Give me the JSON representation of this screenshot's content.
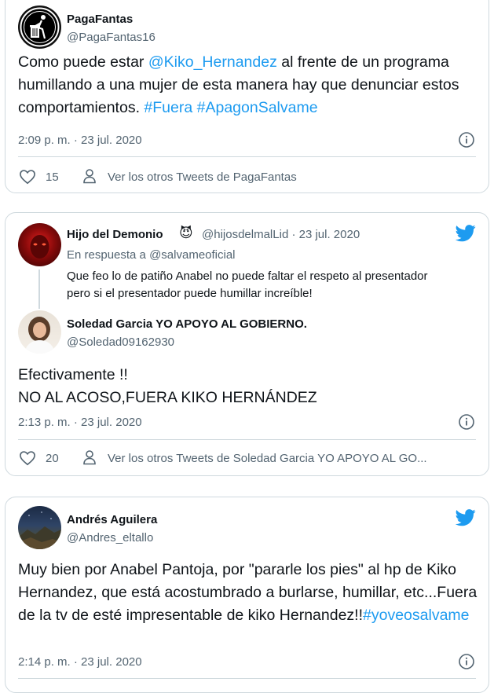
{
  "tweets": [
    {
      "name": "PagaFantas",
      "handle": "@PagaFantas16",
      "text_parts": [
        "Como puede estar ",
        "@Kiko_Hernandez",
        " al frente de un programa humillando a una mujer de esta manera hay que denunciar estos comportamientos. ",
        "#Fuera",
        " ",
        "#ApagonSalvame"
      ],
      "timestamp": "2:09 p. m. · 23 jul. 2020",
      "likes": "15",
      "view_more": "Ver los otros Tweets de PagaFantas"
    },
    {
      "parent": {
        "name": "Hijo del Demonio",
        "emoji": "😈",
        "handle_date": "@hijosdelmalLid · 23 jul. 2020",
        "reply_to_prefix": "En respuesta a ",
        "reply_to_handle": "@salvameoficial",
        "text_line1": "Que feo lo de patiño Anabel no puede faltar el respeto al presentador",
        "text_line2": "pero si el presentador puede humillar increíble!"
      },
      "name": "Soledad Garcia YO APOYO AL GOBIERNO.",
      "handle": "@Soledad09162930",
      "text_line1": "Efectivamente !!",
      "text_line2": "NO AL ACOSO,FUERA KIKO HERNÁNDEZ",
      "timestamp": "2:13 p. m. · 23 jul. 2020",
      "likes": "20",
      "view_more": "Ver los otros Tweets de Soledad Garcia YO APOYO AL GO..."
    },
    {
      "name": "Andrés Aguilera",
      "handle": "@Andres_eltallo",
      "text_main": "Muy bien por Anabel Pantoja, por \"pararle los pies\" al hp de Kiko Hernandez, que está acostumbrado a burlarse, humillar, etc...Fuera de la tv de esté impresentable de kiko Hernandez!!",
      "text_hashtag": "#yoveosalvame",
      "timestamp": "2:14 p. m. · 23 jul. 2020"
    }
  ]
}
